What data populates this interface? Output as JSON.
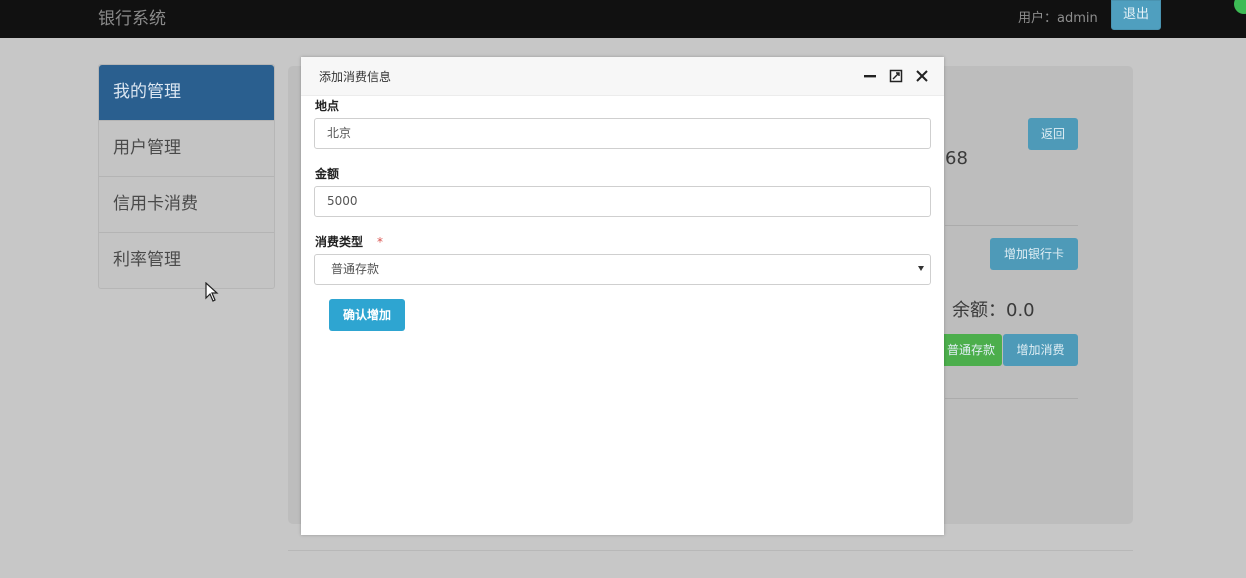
{
  "navbar": {
    "brand": "银行系统",
    "user_text": "用户：admin",
    "logout_label": "退出"
  },
  "sidebar": {
    "items": [
      {
        "label": "我的管理",
        "active": true
      },
      {
        "label": "用户管理",
        "active": false
      },
      {
        "label": "信用卡消费",
        "active": false
      },
      {
        "label": "利率管理",
        "active": false
      }
    ]
  },
  "background_panel": {
    "back_label": "返回",
    "number_fragment": "68",
    "add_card_label": "增加银行卡",
    "balance_text": "余额：0.0",
    "deposit_label": "普通存款",
    "add_consume_label": "增加消费"
  },
  "modal": {
    "title": "添加消费信息",
    "location_label": "地点",
    "location_value": "北京",
    "amount_label": "金额",
    "amount_value": "5000",
    "type_label": "消费类型",
    "required_mark": "*",
    "type_value": "普通存款",
    "confirm_label": "确认增加"
  },
  "colors": {
    "navbar_bg": "#111111",
    "sidebar_active": "#2a5f8f",
    "primary_button": "#2ea5d1",
    "success_button": "#4cae4c",
    "required": "#d9534f"
  },
  "icons": [
    "minimize-icon",
    "maximize-icon",
    "close-icon",
    "cursor-arrow-icon",
    "select-arrow-icon"
  ]
}
